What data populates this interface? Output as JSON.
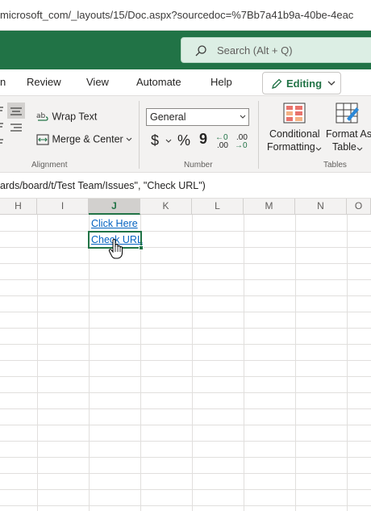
{
  "browser": {
    "url": "microsoft_com/_layouts/15/Doc.aspx?sourcedoc=%7Bb7a41b9a-40be-4eac"
  },
  "header": {
    "search_placeholder": "Search (Alt + Q)",
    "accent": "#217346"
  },
  "tabs": [
    {
      "label": "n"
    },
    {
      "label": "Review"
    },
    {
      "label": "View"
    },
    {
      "label": "Automate"
    },
    {
      "label": "Help"
    }
  ],
  "editing_label": "Editing",
  "ribbon": {
    "alignment": {
      "wrap_text": "Wrap Text",
      "merge_center": "Merge & Center",
      "group_label": "Alignment"
    },
    "number": {
      "format": "General",
      "currency": "$",
      "percent": "%",
      "comma": "9",
      "inc_decimal_top": "←0",
      "inc_decimal_bottom": ".00",
      "dec_decimal_top": ".00",
      "dec_decimal_bottom": "→0",
      "group_label": "Number"
    },
    "tables": {
      "conditional_1": "Conditional",
      "conditional_2": "Formatting",
      "format_as_1": "Format As",
      "format_as_2": "Table",
      "group_label": "Tables"
    }
  },
  "formula_bar": {
    "text": "ards/board/t/Test Team/Issues\", \"Check URL\")"
  },
  "columns": [
    "H",
    "I",
    "J",
    "K",
    "L",
    "M",
    "N",
    "O"
  ],
  "cells": {
    "j1": "Click Here",
    "j2": "Check URL"
  }
}
